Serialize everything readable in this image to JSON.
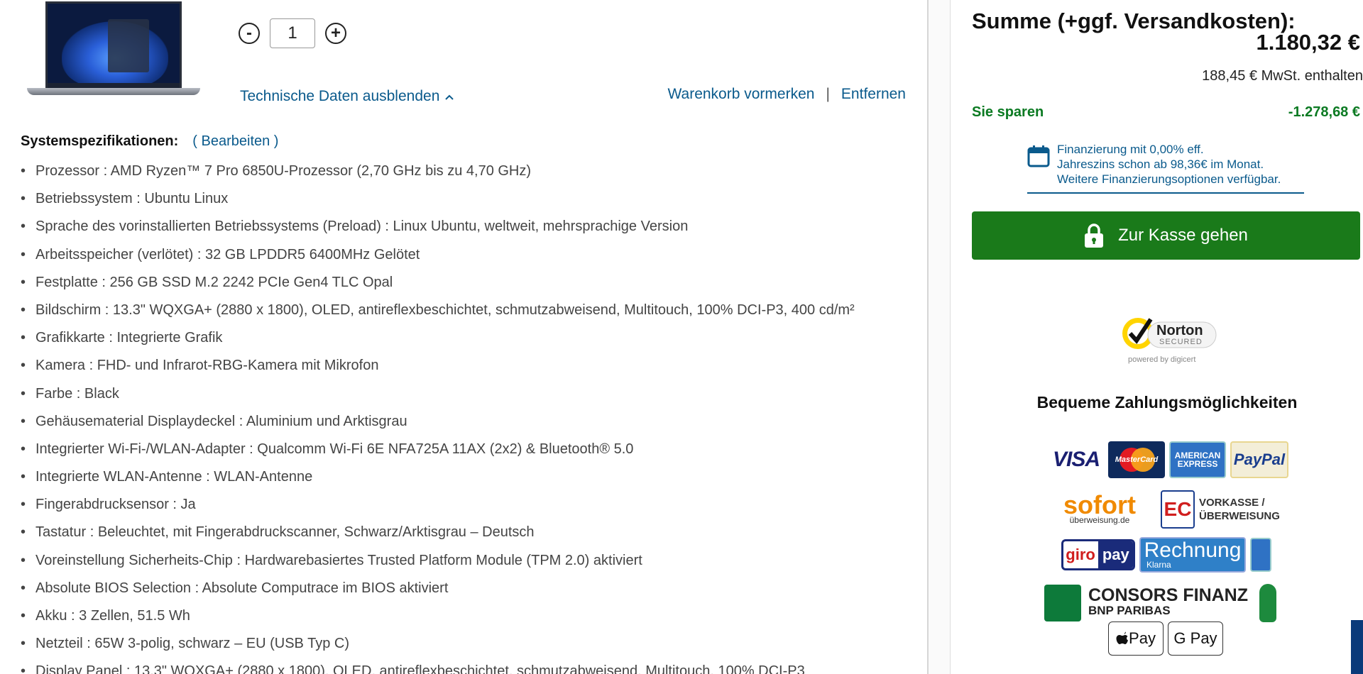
{
  "cart_item": {
    "quantity": {
      "decrement": "-",
      "value": "1",
      "increment": "+"
    },
    "toggle_specs_label": "Technische Daten ausblenden",
    "toggle_specs_icon": "chevron-up-icon",
    "actions": {
      "save_cart": "Warenkorb vormerken",
      "separator": "|",
      "remove": "Entfernen"
    },
    "specs": {
      "heading": "Systemspezifikationen:",
      "edit": "( Bearbeiten )",
      "items": [
        "Prozessor : AMD Ryzen™ 7 Pro 6850U-Prozessor (2,70 GHz bis zu 4,70 GHz)",
        "Betriebssystem : Ubuntu Linux",
        "Sprache des vorinstallierten Betriebssystems (Preload) : Linux Ubuntu, weltweit, mehrsprachige Version",
        "Arbeitsspeicher (verlötet) : 32 GB LPDDR5 6400MHz Gelötet",
        "Festplatte : 256 GB SSD M.2 2242 PCIe Gen4 TLC Opal",
        "Bildschirm : 13.3\" WQXGA+ (2880 x 1800), OLED, antireflexbeschichtet, schmutzabweisend, Multitouch, 100% DCI-P3, 400 cd/m²",
        "Grafikkarte : Integrierte Grafik",
        "Kamera : FHD- und Infrarot-RBG-Kamera mit Mikrofon",
        "Farbe : Black",
        "Gehäusematerial Displaydeckel : Aluminium und Arktisgrau",
        "Integrierter Wi-Fi-/WLAN-Adapter : Qualcomm Wi-Fi 6E NFA725A 11AX (2x2) & Bluetooth® 5.0",
        "Integrierte WLAN-Antenne : WLAN-Antenne",
        "Fingerabdrucksensor : Ja",
        "Tastatur : Beleuchtet, mit Fingerabdruckscanner, Schwarz/Arktisgrau – Deutsch",
        "Voreinstellung Sicherheits-Chip : Hardwarebasiertes Trusted Platform Module (TPM 2.0) aktiviert",
        "Absolute BIOS Selection : Absolute Computrace im BIOS aktiviert",
        "Akku : 3 Zellen, 51.5 Wh",
        "Netzteil : 65W 3-polig, schwarz – EU (USB Typ C)",
        "Display Panel : 13.3\" WQXGA+ (2880 x 1800), OLED, antireflexbeschichtet, schmutzabweisend, Multitouch, 100% DCI-P3"
      ]
    }
  },
  "summary": {
    "total_label": "Summe (+ggf. Versandkosten):",
    "total_value": "1.180,32 €",
    "vat_note": "188,45 € MwSt. enthalten",
    "savings_label": "Sie sparen",
    "savings_value": "-1.278,68 €",
    "savings_color": "#0b7a22",
    "financing": {
      "line1": "Finanzierung mit 0,00% eff.",
      "line2": "Jahreszins schon ab 98,36€ im Monat.",
      "line3": "Weitere Finanzierungsoptionen verfügbar."
    },
    "checkout_label": "Zur Kasse gehen",
    "checkout_color": "#1a7a1a",
    "accent_color": "#0a5a8c"
  },
  "trust": {
    "norton_name": "Norton",
    "norton_sub": "SECURED",
    "norton_powered": "powered by digicert"
  },
  "payment": {
    "title": "Bequeme Zahlungsmöglichkeiten",
    "visa": "VISA",
    "mastercard": "MasterCard",
    "amex_line1": "AMERICAN",
    "amex_line2": "EXPRESS",
    "paypal": "PayPal",
    "sofort": "sofort",
    "sofort_sub": "überweisung.de",
    "ec": "EC",
    "vorkasse_line1": "VORKASSE /",
    "vorkasse_line2": "ÜBERWEISUNG",
    "giro_a": "giro",
    "giro_b": "pay",
    "rechnung": "Rechnung",
    "rechnung_sub": "Klarna",
    "consors_line1": "CONSORS FINANZ",
    "consors_line2": "BNP PARIBAS",
    "apple_pay": "Pay",
    "google_pay": "G Pay"
  }
}
